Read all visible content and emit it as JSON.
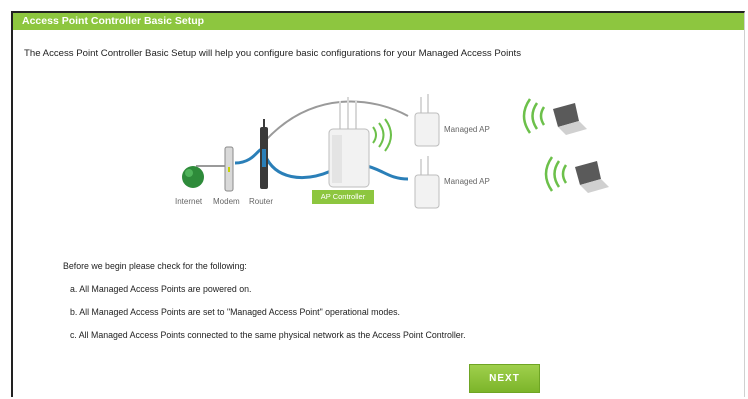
{
  "header": {
    "title": "Access Point Controller Basic Setup"
  },
  "intro": "The Access Point Controller Basic Setup will help you configure basic configurations for your Managed Access Points",
  "diagram": {
    "internet_label": "Internet",
    "modem_label": "Modem",
    "router_label": "Router",
    "ap_controller_label": "AP Controller",
    "managed_ap_1_label": "Managed AP",
    "managed_ap_2_label": "Managed AP"
  },
  "checklist": {
    "lead": "Before we begin please check for the following:",
    "items": [
      "a. All Managed Access Points are powered on.",
      "b. All Managed Access Points are set to \"Managed Access Point\" operational modes.",
      "c. All Managed Access Points connected to the same physical network as the Access Point Controller."
    ]
  },
  "buttons": {
    "next_label": "NEXT"
  },
  "colors": {
    "accent": "#8dc63f",
    "cable_blue": "#2a7fb8",
    "cable_gray": "#9a9a9a"
  }
}
